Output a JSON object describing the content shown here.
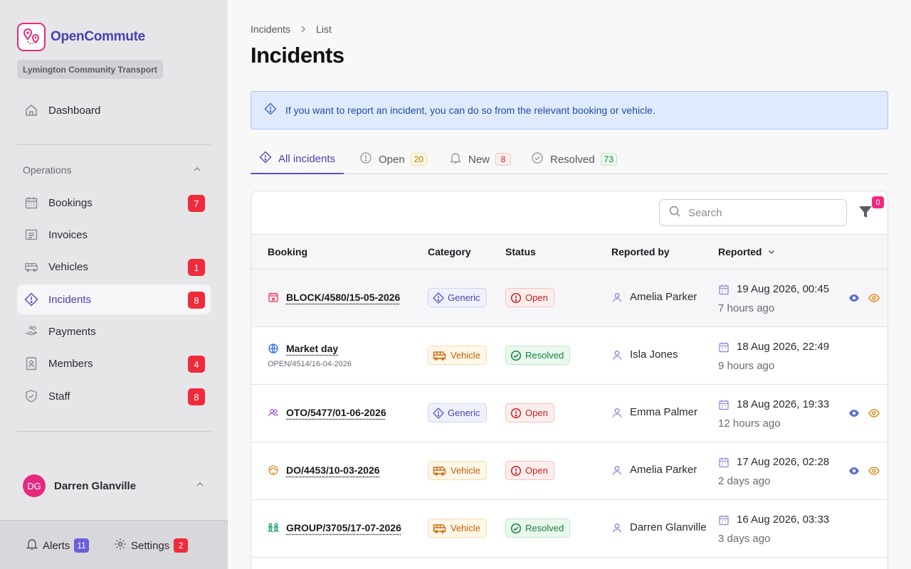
{
  "brand": {
    "name": "OpenCommute",
    "org": "Lymington Community Transport"
  },
  "colors": {
    "accent": "#4a3fb0",
    "brand_pink": "#e5297f",
    "badge_red": "#ef2b3b",
    "alert_purple": "#6b5fd6"
  },
  "nav": {
    "dashboard": "Dashboard",
    "section": "Operations",
    "items": [
      {
        "label": "Bookings",
        "icon": "calendar-icon",
        "badge": "7"
      },
      {
        "label": "Invoices",
        "icon": "invoice-icon",
        "badge": ""
      },
      {
        "label": "Vehicles",
        "icon": "bus-icon",
        "badge": "1"
      },
      {
        "label": "Incidents",
        "icon": "warning-diamond-icon",
        "badge": "8",
        "active": true
      },
      {
        "label": "Payments",
        "icon": "hand-coins-icon",
        "badge": ""
      },
      {
        "label": "Members",
        "icon": "id-card-icon",
        "badge": "4"
      },
      {
        "label": "Staff",
        "icon": "shield-icon",
        "badge": "8"
      }
    ]
  },
  "user": {
    "initials": "DG",
    "name": "Darren Glanville"
  },
  "bottom": {
    "alerts_label": "Alerts",
    "alerts_count": "11",
    "settings_label": "Settings",
    "settings_count": "2"
  },
  "breadcrumb": {
    "parent": "Incidents",
    "current": "List"
  },
  "page_title": "Incidents",
  "info": "If you want to report an incident, you can do so from the relevant booking or vehicle.",
  "tabs": [
    {
      "label": "All incidents",
      "count": "",
      "active": true
    },
    {
      "label": "Open",
      "count": "20"
    },
    {
      "label": "New",
      "count": "8"
    },
    {
      "label": "Resolved",
      "count": "73"
    }
  ],
  "search": {
    "placeholder": "Search"
  },
  "filter_count": "0",
  "columns": {
    "booking": "Booking",
    "category": "Category",
    "status": "Status",
    "reported_by": "Reported by",
    "reported": "Reported"
  },
  "rows": [
    {
      "booking": "BLOCK/4580/15-05-2026",
      "sub": "",
      "booking_icon": "calendar-x-icon",
      "category": "Generic",
      "status": "Open",
      "reporter": "Amelia Parker",
      "date": "19 Aug 2026, 00:45",
      "ago": "7 hours ago",
      "actions": true
    },
    {
      "booking": "Market day",
      "sub": "OPEN/4514/16-04-2026",
      "booking_icon": "globe-icon",
      "category": "Vehicle",
      "status": "Resolved",
      "reporter": "Isla Jones",
      "date": "18 Aug 2026, 22:49",
      "ago": "9 hours ago",
      "actions": false
    },
    {
      "booking": "OTO/5477/01-06-2026",
      "sub": "",
      "booking_icon": "users-icon",
      "category": "Generic",
      "status": "Open",
      "reporter": "Emma Palmer",
      "date": "18 Aug 2026, 19:33",
      "ago": "12 hours ago",
      "actions": true
    },
    {
      "booking": "DO/4453/10-03-2026",
      "sub": "",
      "booking_icon": "steering-wheel-icon",
      "category": "Vehicle",
      "status": "Open",
      "reporter": "Amelia Parker",
      "date": "17 Aug 2026, 02:28",
      "ago": "2 days ago",
      "actions": true
    },
    {
      "booking": "GROUP/3705/17-07-2026",
      "sub": "",
      "booking_icon": "group-icon",
      "category": "Vehicle",
      "status": "Resolved",
      "reporter": "Darren Glanville",
      "date": "16 Aug 2026, 03:33",
      "ago": "3 days ago",
      "actions": false
    }
  ]
}
